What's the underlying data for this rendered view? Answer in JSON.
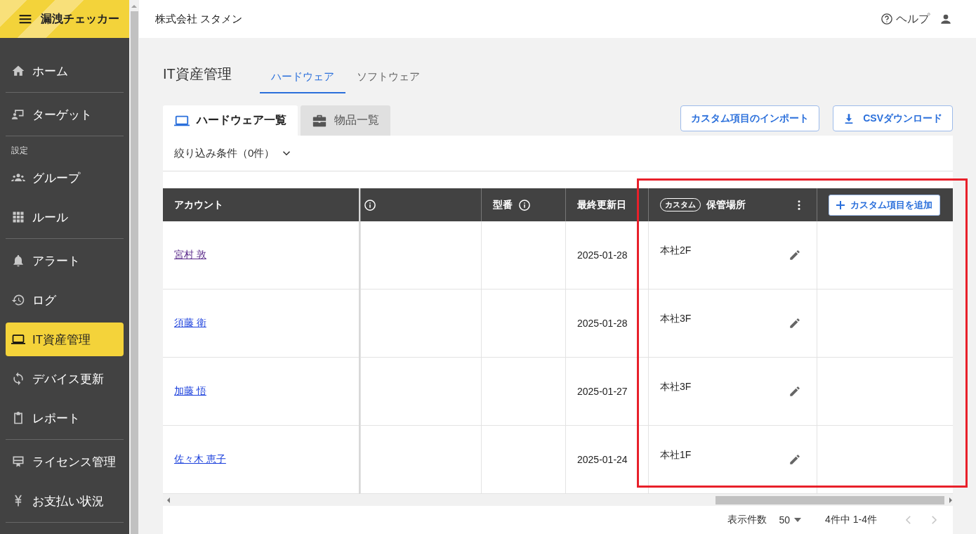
{
  "app": {
    "title": "漏洩チェッカー"
  },
  "sidebar": {
    "groups": [
      {
        "items": [
          {
            "label": "ホーム",
            "selected": false
          }
        ]
      },
      {
        "items": [
          {
            "label": "ターゲット",
            "selected": false
          }
        ]
      },
      {
        "heading": "設定",
        "items": [
          {
            "label": "グループ",
            "selected": false
          },
          {
            "label": "ルール",
            "selected": false
          }
        ]
      },
      {
        "items": [
          {
            "label": "アラート",
            "selected": false
          },
          {
            "label": "ログ",
            "selected": false
          },
          {
            "label": "IT資産管理",
            "selected": true
          },
          {
            "label": "デバイス更新",
            "selected": false
          },
          {
            "label": "レポート",
            "selected": false
          }
        ]
      },
      {
        "items": [
          {
            "label": "ライセンス管理",
            "selected": false
          },
          {
            "label": "お支払い状況",
            "selected": false
          }
        ]
      }
    ]
  },
  "header": {
    "company": "株式会社 スタメン",
    "help": "ヘルプ"
  },
  "page": {
    "title": "IT資産管理",
    "tabs": [
      {
        "label": "ハードウェア",
        "selected": true
      },
      {
        "label": "ソフトウェア",
        "selected": false
      }
    ]
  },
  "subtabs": [
    {
      "label": "ハードウェア一覧",
      "selected": true
    },
    {
      "label": "物品一覧",
      "selected": false
    }
  ],
  "actions": [
    {
      "label": "カスタム項目のインポート"
    },
    {
      "label": "CSVダウンロード"
    }
  ],
  "filter": {
    "label": "絞り込み条件（0件）",
    "expanded": false
  },
  "table": {
    "columns": [
      {
        "label": "アカウント"
      },
      {
        "info": true
      },
      {
        "label": "型番",
        "info": true
      },
      {
        "label": "最終更新日"
      },
      {
        "badge": "カスタム",
        "label": "保管場所",
        "menu": true
      }
    ],
    "add_button": "カスタム項目を追加",
    "rows": [
      {
        "account": "宮村 敦",
        "visited": true,
        "date": "2025-01-28",
        "location": "本社2F"
      },
      {
        "account": "須藤 衛",
        "visited": false,
        "date": "2025-01-28",
        "location": "本社3F"
      },
      {
        "account": "加藤 悟",
        "visited": false,
        "date": "2025-01-27",
        "location": "本社3F"
      },
      {
        "account": "佐々木 恵子",
        "visited": false,
        "date": "2025-01-24",
        "location": "本社1F"
      }
    ]
  },
  "footer": {
    "page_size_label": "表示件数",
    "page_size": "50",
    "range": "4件中 1-4件",
    "prev": {
      "disabled": true
    },
    "next": {
      "disabled": true
    }
  }
}
